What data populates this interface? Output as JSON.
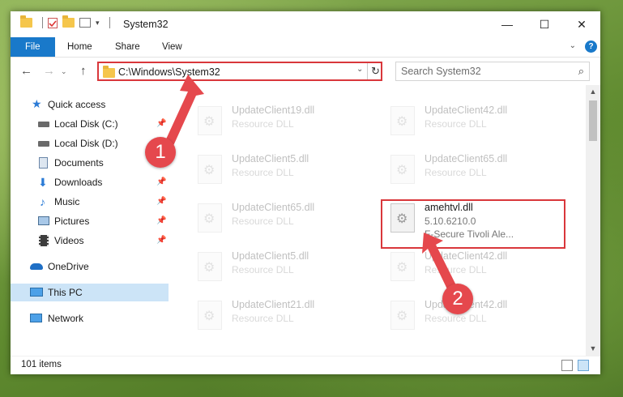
{
  "window": {
    "title": "System32",
    "controls": {
      "minimize": "—",
      "maximize": "☐",
      "close": "✕"
    }
  },
  "ribbon": {
    "tabs": [
      "File",
      "Home",
      "Share",
      "View"
    ],
    "help": "?"
  },
  "address_bar": {
    "path": "C:\\Windows\\System32"
  },
  "search": {
    "placeholder": "Search System32"
  },
  "nav_pane": {
    "items": [
      {
        "label": "Quick access",
        "icon": "star-icon",
        "pinned": false
      },
      {
        "label": "Local Disk (C:)",
        "icon": "drive-icon",
        "pinned": true
      },
      {
        "label": "Local Disk (D:)",
        "icon": "drive-icon",
        "pinned": false
      },
      {
        "label": "Documents",
        "icon": "documents-icon",
        "pinned": true
      },
      {
        "label": "Downloads",
        "icon": "download-icon",
        "pinned": true
      },
      {
        "label": "Music",
        "icon": "music-icon",
        "pinned": true
      },
      {
        "label": "Pictures",
        "icon": "pictures-icon",
        "pinned": true
      },
      {
        "label": "Videos",
        "icon": "videos-icon",
        "pinned": true
      },
      {
        "label": "OneDrive",
        "icon": "onedrive-icon",
        "pinned": false
      },
      {
        "label": "This PC",
        "icon": "pc-icon",
        "pinned": false,
        "selected": true
      },
      {
        "label": "Network",
        "icon": "network-icon",
        "pinned": false
      }
    ]
  },
  "files": {
    "left": [
      {
        "name": "UpdateClient19.dll",
        "desc": "Resource DLL"
      },
      {
        "name": "UpdateClient5.dll",
        "desc": "Resource DLL"
      },
      {
        "name": "UpdateClient65.dll",
        "desc": "Resource DLL"
      },
      {
        "name": "UpdateClient5.dll",
        "desc": "Resource DLL"
      },
      {
        "name": "UpdateClient21.dll",
        "desc": "Resource DLL"
      }
    ],
    "right": [
      {
        "name": "UpdateClient42.dll",
        "desc": "Resource DLL"
      },
      {
        "name": "UpdateClient65.dll",
        "desc": "Resource DLL"
      },
      {
        "name": "UpdateClient42.dll",
        "desc": "Resource DLL"
      },
      {
        "name": "UpdateClient42.dll",
        "desc": "Resource DLL"
      }
    ],
    "highlighted": {
      "name": "amehtvl.dll",
      "version": "5.10.6210.0",
      "company": "F-Secure Tivoli Ale..."
    }
  },
  "status": {
    "items": "101 items"
  },
  "annotations": {
    "step1": "1",
    "step2": "2",
    "color": "#e5484d"
  }
}
